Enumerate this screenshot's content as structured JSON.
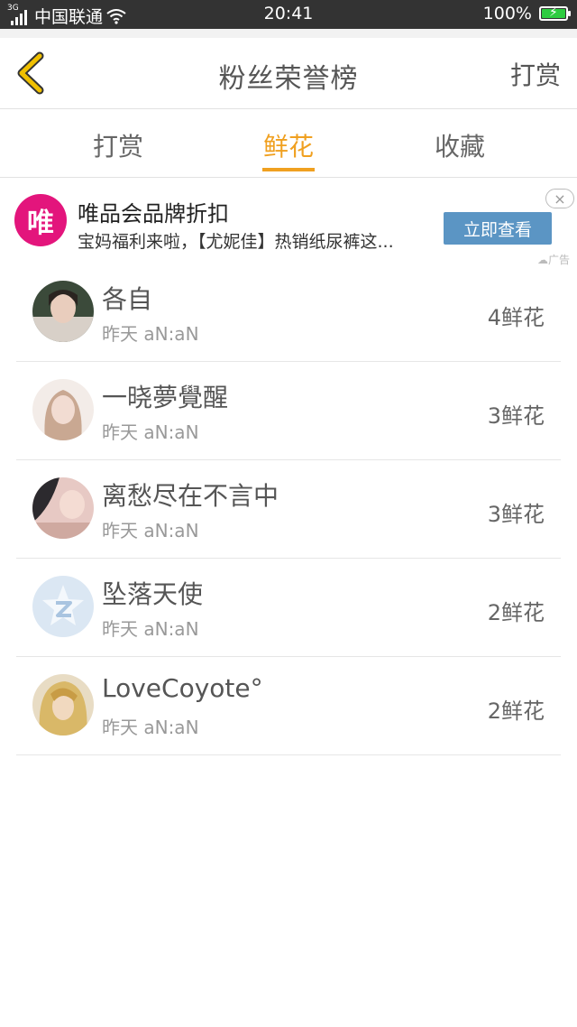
{
  "statusbar": {
    "network": "3G",
    "carrier": "中国联通",
    "time": "20:41",
    "battery": "100%",
    "battery_level": 1.0,
    "battery_color": "#2ecc40"
  },
  "header": {
    "back_icon": "chevron-left-icon",
    "back_color": "#f0c000",
    "title": "粉丝荣誉榜",
    "action": "打赏"
  },
  "tabs": [
    {
      "label": "打赏",
      "active": false
    },
    {
      "label": "鲜花",
      "active": true
    },
    {
      "label": "收藏",
      "active": false
    }
  ],
  "accent_color": "#f0a020",
  "ad": {
    "logo_text": "唯",
    "logo_color": "#e3157c",
    "title": "唯品会品牌折扣",
    "desc": "宝妈福利来啦，【尤妮佳】热销纸尿裤这...",
    "button": "立即查看",
    "close": "×",
    "tag": "广告"
  },
  "list": [
    {
      "name": "各自",
      "time": "昨天 aN:aN",
      "count": "4鲜花",
      "avatar_icon": "user-photo-icon"
    },
    {
      "name": "一晓夢覺醒",
      "time": "昨天 aN:aN",
      "count": "3鲜花",
      "avatar_icon": "user-photo-icon"
    },
    {
      "name": "离愁尽在不言中",
      "time": "昨天 aN:aN",
      "count": "3鲜花",
      "avatar_icon": "user-photo-icon"
    },
    {
      "name": "坠落天使",
      "time": "昨天 aN:aN",
      "count": "2鲜花",
      "avatar_icon": "qq-default-avatar-icon"
    },
    {
      "name": "LoveCoyote°",
      "time": "昨天 aN:aN",
      "count": "2鲜花",
      "avatar_icon": "user-photo-icon"
    }
  ]
}
